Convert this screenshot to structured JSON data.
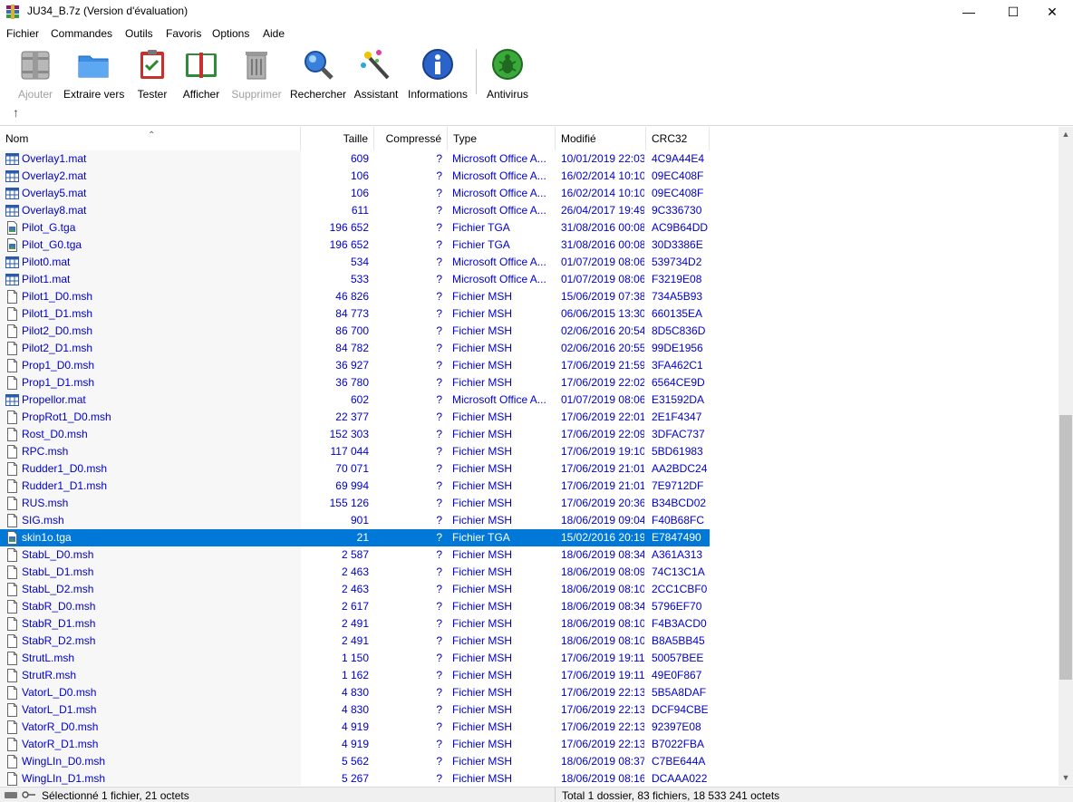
{
  "window": {
    "title": "JU34_B.7z (Version d'évaluation)",
    "minimize": "—",
    "maximize": "☐",
    "close": "✕"
  },
  "menu": [
    "Fichier",
    "Commandes",
    "Outils",
    "Favoris",
    "Options",
    "Aide"
  ],
  "toolbar": [
    {
      "label": "Ajouter",
      "icon": "archive-add-icon",
      "disabled": true
    },
    {
      "label": "Extraire vers",
      "icon": "folder-extract-icon",
      "disabled": false
    },
    {
      "label": "Tester",
      "icon": "clipboard-test-icon",
      "disabled": false
    },
    {
      "label": "Afficher",
      "icon": "book-view-icon",
      "disabled": false
    },
    {
      "label": "Supprimer",
      "icon": "trash-icon",
      "disabled": true
    },
    {
      "label": "Rechercher",
      "icon": "magnifier-icon",
      "disabled": false
    },
    {
      "label": "Assistant",
      "icon": "magic-wand-icon",
      "disabled": false
    },
    {
      "label": "Informations",
      "icon": "info-icon",
      "disabled": false
    },
    {
      "label": "Antivirus",
      "icon": "antivirus-bug-icon",
      "disabled": false
    }
  ],
  "columns": {
    "name": "Nom",
    "size": "Taille",
    "compressed": "Compressé",
    "type": "Type",
    "modified": "Modifié",
    "crc": "CRC32"
  },
  "files": [
    {
      "name": "Overlay1.mat",
      "size": "609",
      "comp": "?",
      "type": "Microsoft Office A...",
      "modified": "10/01/2019 22:03",
      "crc": "4C9A44E4",
      "icon": "mat"
    },
    {
      "name": "Overlay2.mat",
      "size": "106",
      "comp": "?",
      "type": "Microsoft Office A...",
      "modified": "16/02/2014 10:10",
      "crc": "09EC408F",
      "icon": "mat"
    },
    {
      "name": "Overlay5.mat",
      "size": "106",
      "comp": "?",
      "type": "Microsoft Office A...",
      "modified": "16/02/2014 10:10",
      "crc": "09EC408F",
      "icon": "mat"
    },
    {
      "name": "Overlay8.mat",
      "size": "611",
      "comp": "?",
      "type": "Microsoft Office A...",
      "modified": "26/04/2017 19:49",
      "crc": "9C336730",
      "icon": "mat"
    },
    {
      "name": "Pilot_G.tga",
      "size": "196 652",
      "comp": "?",
      "type": "Fichier TGA",
      "modified": "31/08/2016 00:08",
      "crc": "AC9B64DD",
      "icon": "tga"
    },
    {
      "name": "Pilot_G0.tga",
      "size": "196 652",
      "comp": "?",
      "type": "Fichier TGA",
      "modified": "31/08/2016 00:08",
      "crc": "30D3386E",
      "icon": "tga"
    },
    {
      "name": "Pilot0.mat",
      "size": "534",
      "comp": "?",
      "type": "Microsoft Office A...",
      "modified": "01/07/2019 08:06",
      "crc": "539734D2",
      "icon": "mat"
    },
    {
      "name": "Pilot1.mat",
      "size": "533",
      "comp": "?",
      "type": "Microsoft Office A...",
      "modified": "01/07/2019 08:06",
      "crc": "F3219E08",
      "icon": "mat"
    },
    {
      "name": "Pilot1_D0.msh",
      "size": "46 826",
      "comp": "?",
      "type": "Fichier MSH",
      "modified": "15/06/2019 07:38",
      "crc": "734A5B93",
      "icon": "file"
    },
    {
      "name": "Pilot1_D1.msh",
      "size": "84 773",
      "comp": "?",
      "type": "Fichier MSH",
      "modified": "06/06/2015 13:30",
      "crc": "660135EA",
      "icon": "file"
    },
    {
      "name": "Pilot2_D0.msh",
      "size": "86 700",
      "comp": "?",
      "type": "Fichier MSH",
      "modified": "02/06/2016 20:54",
      "crc": "8D5C836D",
      "icon": "file"
    },
    {
      "name": "Pilot2_D1.msh",
      "size": "84 782",
      "comp": "?",
      "type": "Fichier MSH",
      "modified": "02/06/2016 20:55",
      "crc": "99DE1956",
      "icon": "file"
    },
    {
      "name": "Prop1_D0.msh",
      "size": "36 927",
      "comp": "?",
      "type": "Fichier MSH",
      "modified": "17/06/2019 21:59",
      "crc": "3FA462C1",
      "icon": "file"
    },
    {
      "name": "Prop1_D1.msh",
      "size": "36 780",
      "comp": "?",
      "type": "Fichier MSH",
      "modified": "17/06/2019 22:02",
      "crc": "6564CE9D",
      "icon": "file"
    },
    {
      "name": "Propellor.mat",
      "size": "602",
      "comp": "?",
      "type": "Microsoft Office A...",
      "modified": "01/07/2019 08:06",
      "crc": "E31592DA",
      "icon": "mat"
    },
    {
      "name": "PropRot1_D0.msh",
      "size": "22 377",
      "comp": "?",
      "type": "Fichier MSH",
      "modified": "17/06/2019 22:01",
      "crc": "2E1F4347",
      "icon": "file"
    },
    {
      "name": "Rost_D0.msh",
      "size": "152 303",
      "comp": "?",
      "type": "Fichier MSH",
      "modified": "17/06/2019 22:09",
      "crc": "3DFAC737",
      "icon": "file"
    },
    {
      "name": "RPC.msh",
      "size": "117 044",
      "comp": "?",
      "type": "Fichier MSH",
      "modified": "17/06/2019 19:10",
      "crc": "5BD61983",
      "icon": "file"
    },
    {
      "name": "Rudder1_D0.msh",
      "size": "70 071",
      "comp": "?",
      "type": "Fichier MSH",
      "modified": "17/06/2019 21:01",
      "crc": "AA2BDC24",
      "icon": "file"
    },
    {
      "name": "Rudder1_D1.msh",
      "size": "69 994",
      "comp": "?",
      "type": "Fichier MSH",
      "modified": "17/06/2019 21:01",
      "crc": "7E9712DF",
      "icon": "file"
    },
    {
      "name": "RUS.msh",
      "size": "155 126",
      "comp": "?",
      "type": "Fichier MSH",
      "modified": "17/06/2019 20:36",
      "crc": "B34BCD02",
      "icon": "file"
    },
    {
      "name": "SIG.msh",
      "size": "901",
      "comp": "?",
      "type": "Fichier MSH",
      "modified": "18/06/2019 09:04",
      "crc": "F40B68FC",
      "icon": "file"
    },
    {
      "name": "skin1o.tga",
      "size": "21",
      "comp": "?",
      "type": "Fichier TGA",
      "modified": "15/02/2016 20:19",
      "crc": "E7847490",
      "icon": "tga",
      "selected": true
    },
    {
      "name": "StabL_D0.msh",
      "size": "2 587",
      "comp": "?",
      "type": "Fichier MSH",
      "modified": "18/06/2019 08:34",
      "crc": "A361A313",
      "icon": "file"
    },
    {
      "name": "StabL_D1.msh",
      "size": "2 463",
      "comp": "?",
      "type": "Fichier MSH",
      "modified": "18/06/2019 08:09",
      "crc": "74C13C1A",
      "icon": "file"
    },
    {
      "name": "StabL_D2.msh",
      "size": "2 463",
      "comp": "?",
      "type": "Fichier MSH",
      "modified": "18/06/2019 08:10",
      "crc": "2CC1CBF0",
      "icon": "file"
    },
    {
      "name": "StabR_D0.msh",
      "size": "2 617",
      "comp": "?",
      "type": "Fichier MSH",
      "modified": "18/06/2019 08:34",
      "crc": "5796EF70",
      "icon": "file"
    },
    {
      "name": "StabR_D1.msh",
      "size": "2 491",
      "comp": "?",
      "type": "Fichier MSH",
      "modified": "18/06/2019 08:10",
      "crc": "F4B3ACD0",
      "icon": "file"
    },
    {
      "name": "StabR_D2.msh",
      "size": "2 491",
      "comp": "?",
      "type": "Fichier MSH",
      "modified": "18/06/2019 08:10",
      "crc": "B8A5BB45",
      "icon": "file"
    },
    {
      "name": "StrutL.msh",
      "size": "1 150",
      "comp": "?",
      "type": "Fichier MSH",
      "modified": "17/06/2019 19:11",
      "crc": "50057BEE",
      "icon": "file"
    },
    {
      "name": "StrutR.msh",
      "size": "1 162",
      "comp": "?",
      "type": "Fichier MSH",
      "modified": "17/06/2019 19:11",
      "crc": "49E0F867",
      "icon": "file"
    },
    {
      "name": "VatorL_D0.msh",
      "size": "4 830",
      "comp": "?",
      "type": "Fichier MSH",
      "modified": "17/06/2019 22:13",
      "crc": "5B5A8DAF",
      "icon": "file"
    },
    {
      "name": "VatorL_D1.msh",
      "size": "4 830",
      "comp": "?",
      "type": "Fichier MSH",
      "modified": "17/06/2019 22:13",
      "crc": "DCF94CBE",
      "icon": "file"
    },
    {
      "name": "VatorR_D0.msh",
      "size": "4 919",
      "comp": "?",
      "type": "Fichier MSH",
      "modified": "17/06/2019 22:13",
      "crc": "92397E08",
      "icon": "file"
    },
    {
      "name": "VatorR_D1.msh",
      "size": "4 919",
      "comp": "?",
      "type": "Fichier MSH",
      "modified": "17/06/2019 22:13",
      "crc": "B7022FBA",
      "icon": "file"
    },
    {
      "name": "WingLIn_D0.msh",
      "size": "5 562",
      "comp": "?",
      "type": "Fichier MSH",
      "modified": "18/06/2019 08:37",
      "crc": "C7BE644A",
      "icon": "file"
    },
    {
      "name": "WingLIn_D1.msh",
      "size": "5 267",
      "comp": "?",
      "type": "Fichier MSH",
      "modified": "18/06/2019 08:16",
      "crc": "DCAAA022",
      "icon": "file"
    }
  ],
  "status": {
    "left": "Sélectionné 1 fichier, 21 octets",
    "right": "Total 1 dossier, 83 fichiers, 18 533 241 octets"
  },
  "colors": {
    "selection": "#0078d7",
    "file_text": "#0000cc"
  }
}
